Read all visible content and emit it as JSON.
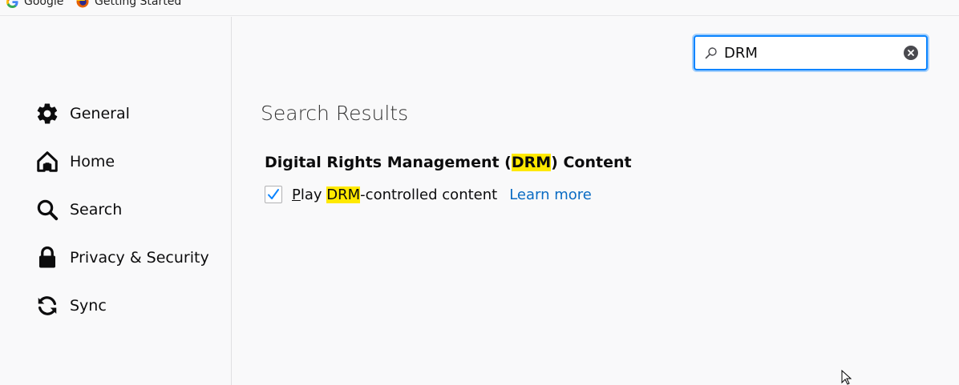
{
  "bookmarks": [
    {
      "label": "Google",
      "icon": "google-favicon"
    },
    {
      "label": "Getting Started",
      "icon": "firefox-favicon"
    }
  ],
  "sidebar": {
    "items": [
      {
        "label": "General",
        "icon": "gear-icon"
      },
      {
        "label": "Home",
        "icon": "home-icon"
      },
      {
        "label": "Search",
        "icon": "search-icon"
      },
      {
        "label": "Privacy & Security",
        "icon": "lock-icon"
      },
      {
        "label": "Sync",
        "icon": "sync-icon"
      }
    ]
  },
  "search": {
    "value": "DRM",
    "icon": "magnifier-icon",
    "clear_icon": "clear-icon"
  },
  "results": {
    "title": "Search Results",
    "section": {
      "heading_before": "Digital Rights Management (",
      "heading_highlight": "DRM",
      "heading_after": ") Content"
    },
    "checkbox": {
      "checked": true,
      "label_access_key": "P",
      "label_before": "lay ",
      "label_highlight": "DRM",
      "label_after": "-controlled content",
      "link": "Learn more"
    }
  },
  "colors": {
    "accent": "#0a84ff",
    "highlight": "#ffe900",
    "link": "#0a6bc3",
    "background": "#f9f9fa"
  }
}
